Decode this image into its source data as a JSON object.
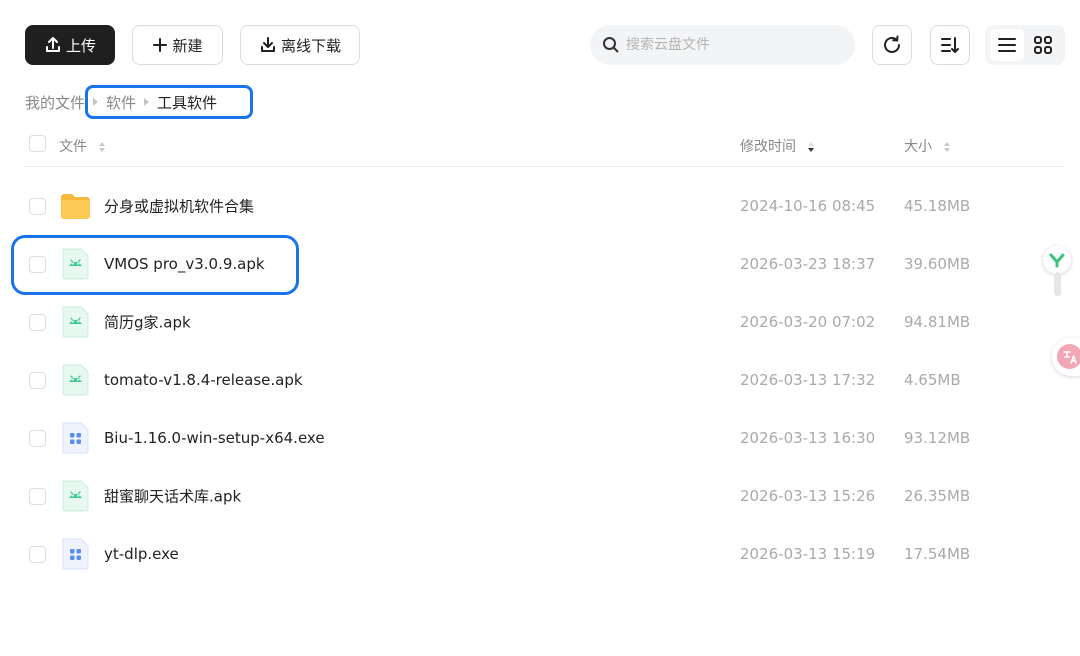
{
  "toolbar": {
    "upload_label": "上传",
    "new_label": "新建",
    "offline_label": "离线下载",
    "search_placeholder": "搜索云盘文件"
  },
  "breadcrumb": [
    "我的文件",
    "软件",
    "工具软件"
  ],
  "columns": {
    "name": "文件",
    "modified": "修改时间",
    "size": "大小"
  },
  "files": [
    {
      "name": "分身或虚拟机软件合集",
      "modified": "2024-10-16 08:45",
      "size": "45.18MB",
      "icon": "folder-icon"
    },
    {
      "name": "VMOS pro_v3.0.9.apk",
      "modified": "2026-03-23 18:37",
      "size": "39.60MB",
      "icon": "apk-file-icon"
    },
    {
      "name": "简历g家.apk",
      "modified": "2026-03-20 07:02",
      "size": "94.81MB",
      "icon": "apk-file-icon"
    },
    {
      "name": "tomato-v1.8.4-release.apk",
      "modified": "2026-03-13 17:32",
      "size": "4.65MB",
      "icon": "apk-file-icon"
    },
    {
      "name": "Biu-1.16.0-win-setup-x64.exe",
      "modified": "2026-03-13 16:30",
      "size": "93.12MB",
      "icon": "exe-file-icon"
    },
    {
      "name": "甜蜜聊天话术库.apk",
      "modified": "2026-03-13 15:26",
      "size": "26.35MB",
      "icon": "apk-file-icon"
    },
    {
      "name": "yt-dlp.exe",
      "modified": "2026-03-13 15:19",
      "size": "17.54MB",
      "icon": "exe-file-icon"
    }
  ],
  "colors": {
    "primary_button": "#1f1f1f",
    "highlight": "#1a73e8",
    "folder": "#fbc84d",
    "apk": "#3ec995",
    "exe": "#5b8def"
  }
}
